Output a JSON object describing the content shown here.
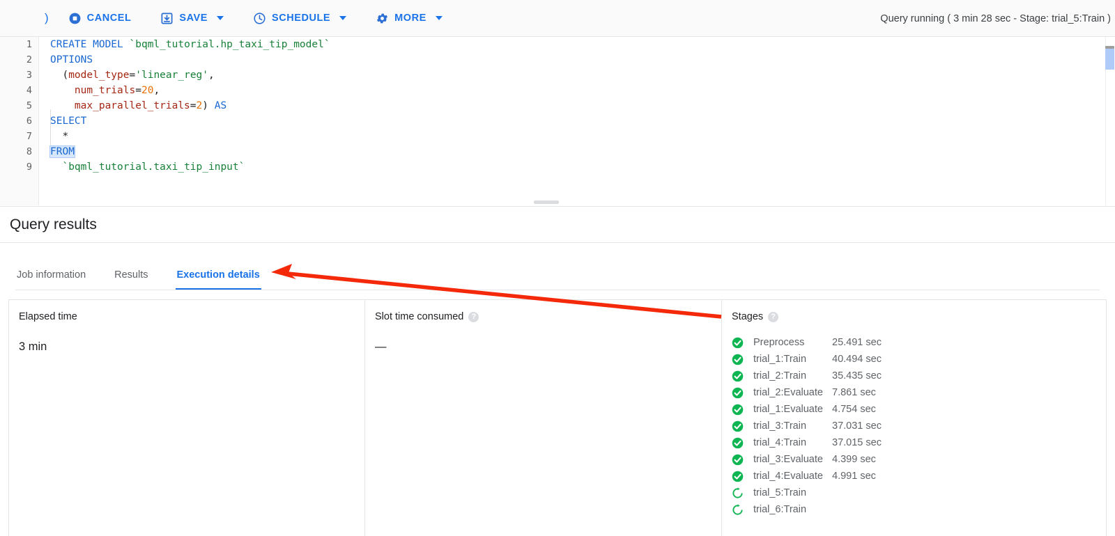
{
  "toolbar": {
    "leading_glyph": ")",
    "buttons": [
      {
        "label": "CANCEL",
        "icon": "stop-circle-icon",
        "has_caret": false
      },
      {
        "label": "SAVE",
        "icon": "save-icon",
        "has_caret": true
      },
      {
        "label": "SCHEDULE",
        "icon": "clock-icon",
        "has_caret": true
      },
      {
        "label": "MORE",
        "icon": "gear-icon",
        "has_caret": true
      }
    ],
    "status": "Query running ( 3 min 28 sec - Stage: trial_5:Train )",
    "accent_color": "#1a73e8"
  },
  "editor": {
    "line_numbers": [
      "1",
      "2",
      "3",
      "4",
      "5",
      "6",
      "7",
      "8",
      "9"
    ],
    "lines": [
      {
        "n": "1",
        "tokens": [
          {
            "t": "CREATE MODEL ",
            "c": "k-key"
          },
          {
            "t": "`bqml_tutorial.hp_taxi_tip_model`",
            "c": "k-tick"
          }
        ]
      },
      {
        "n": "2",
        "tokens": [
          {
            "t": "OPTIONS",
            "c": "k-key"
          }
        ]
      },
      {
        "n": "3",
        "tokens": [
          {
            "t": "  (",
            "c": "k-plain"
          },
          {
            "t": "model_type",
            "c": "k-field"
          },
          {
            "t": "=",
            "c": "k-plain"
          },
          {
            "t": "'linear_reg'",
            "c": "k-str"
          },
          {
            "t": ",",
            "c": "k-plain"
          }
        ]
      },
      {
        "n": "4",
        "tokens": [
          {
            "t": "    ",
            "c": "k-plain"
          },
          {
            "t": "num_trials",
            "c": "k-field"
          },
          {
            "t": "=",
            "c": "k-plain"
          },
          {
            "t": "20",
            "c": "k-num"
          },
          {
            "t": ",",
            "c": "k-plain"
          }
        ]
      },
      {
        "n": "5",
        "tokens": [
          {
            "t": "    ",
            "c": "k-plain"
          },
          {
            "t": "max_parallel_trials",
            "c": "k-field"
          },
          {
            "t": "=",
            "c": "k-plain"
          },
          {
            "t": "2",
            "c": "k-num"
          },
          {
            "t": ") ",
            "c": "k-plain"
          },
          {
            "t": "AS",
            "c": "k-key"
          }
        ]
      },
      {
        "n": "6",
        "tokens": [
          {
            "t": "SELECT",
            "c": "k-key"
          }
        ]
      },
      {
        "n": "7",
        "tokens": [
          {
            "t": "  *",
            "c": "k-plain"
          }
        ]
      },
      {
        "n": "8",
        "tokens": [
          {
            "t": "FROM",
            "c": "k-key sel-token"
          }
        ]
      },
      {
        "n": "9",
        "tokens": [
          {
            "t": "  ",
            "c": "k-plain"
          },
          {
            "t": "`bqml_tutorial.taxi_tip_input`",
            "c": "k-tick"
          }
        ]
      }
    ]
  },
  "results": {
    "title": "Query results",
    "tabs": [
      {
        "label": "Job information",
        "active": false
      },
      {
        "label": "Results",
        "active": false
      },
      {
        "label": "Execution details",
        "active": true
      }
    ]
  },
  "panels": {
    "elapsed": {
      "label": "Elapsed time",
      "value": "3 min"
    },
    "slot": {
      "label": "Slot time consumed",
      "value": "—",
      "help": "?"
    },
    "stages": {
      "label": "Stages",
      "help": "?",
      "items": [
        {
          "status": "done",
          "name": "Preprocess",
          "duration": "25.491 sec"
        },
        {
          "status": "done",
          "name": "trial_1:Train",
          "duration": "40.494 sec"
        },
        {
          "status": "done",
          "name": "trial_2:Train",
          "duration": "35.435 sec"
        },
        {
          "status": "done",
          "name": "trial_2:Evaluate",
          "duration": "7.861 sec"
        },
        {
          "status": "done",
          "name": "trial_1:Evaluate",
          "duration": "4.754 sec"
        },
        {
          "status": "done",
          "name": "trial_3:Train",
          "duration": "37.031 sec"
        },
        {
          "status": "done",
          "name": "trial_4:Train",
          "duration": "37.015 sec"
        },
        {
          "status": "done",
          "name": "trial_3:Evaluate",
          "duration": "4.399 sec"
        },
        {
          "status": "done",
          "name": "trial_4:Evaluate",
          "duration": "4.991 sec"
        },
        {
          "status": "running",
          "name": "trial_5:Train",
          "duration": ""
        },
        {
          "status": "running",
          "name": "trial_6:Train",
          "duration": ""
        }
      ],
      "done_color": "#0fb552",
      "running_color": "#0fb552"
    }
  },
  "annotation": {
    "color": "#f4290a",
    "kind": "arrow-pointing-to-execution-details-tab"
  }
}
